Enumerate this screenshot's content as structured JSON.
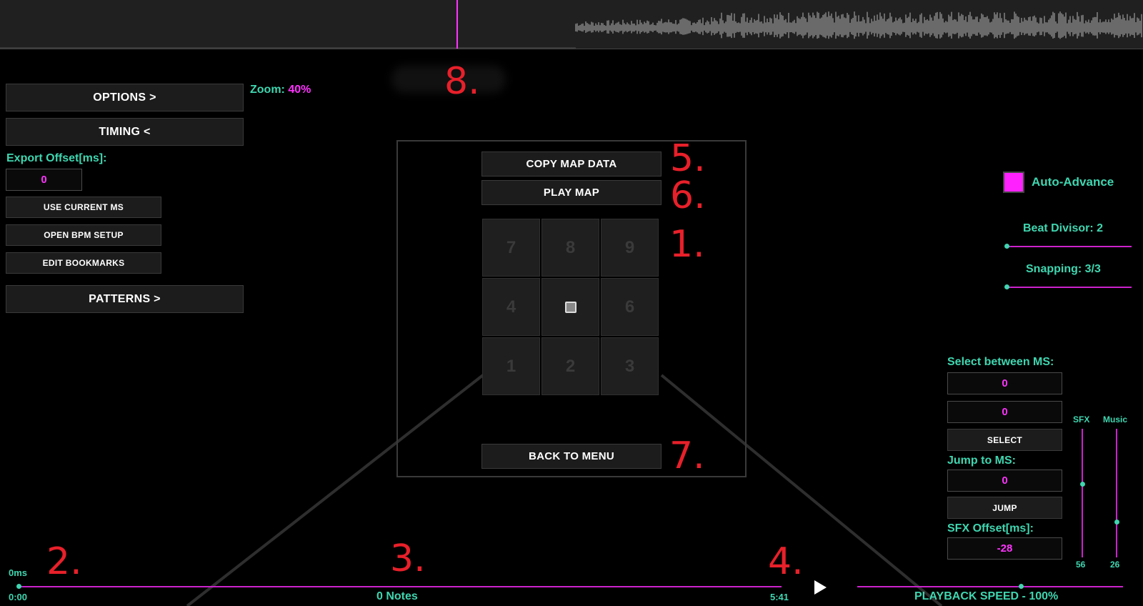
{
  "top_labels": {
    "zoom_label": "Zoom:",
    "zoom_value": "40%"
  },
  "left_menu": {
    "options": "OPTIONS >",
    "timing": "TIMING <",
    "export_offset_label": "Export Offset[ms]:",
    "export_offset_value": "0",
    "use_current_ms": "USE CURRENT MS",
    "open_bpm_setup": "OPEN BPM SETUP",
    "edit_bookmarks": "EDIT BOOKMARKS",
    "patterns": "PATTERNS >"
  },
  "center_panel": {
    "copy_map_data": "COPY MAP DATA",
    "play_map": "PLAY MAP",
    "back_to_menu": "BACK TO MENU",
    "grid": [
      "7",
      "8",
      "9",
      "4",
      "",
      "6",
      "1",
      "2",
      "3"
    ]
  },
  "annotations": {
    "n1": "1.",
    "n2": "2.",
    "n3": "3.",
    "n4": "4.",
    "n5": "5.",
    "n6": "6.",
    "n7": "7.",
    "n8": "8."
  },
  "right_panel": {
    "auto_advance": "Auto-Advance",
    "beat_divisor": "Beat Divisor: 2",
    "snapping": "Snapping: 3/3",
    "select_between_label": "Select between MS:",
    "select_from": "0",
    "select_to": "0",
    "select_button": "SELECT",
    "jump_label": "Jump to MS:",
    "jump_value": "0",
    "jump_button": "JUMP",
    "sfx_offset_label": "SFX Offset[ms]:",
    "sfx_offset_value": "-28",
    "sfx_label": "SFX",
    "sfx_value": "56",
    "music_label": "Music",
    "music_value": "26"
  },
  "timeline": {
    "current_ms": "0ms",
    "start_time": "0:00",
    "end_time": "5:41",
    "notes_count": "0 Notes",
    "playback_speed": "PLAYBACK SPEED - 100%"
  },
  "colors": {
    "accent_teal": "#3fd6b0",
    "accent_magenta": "#ff33ff",
    "annotation_red": "#e8202a"
  }
}
